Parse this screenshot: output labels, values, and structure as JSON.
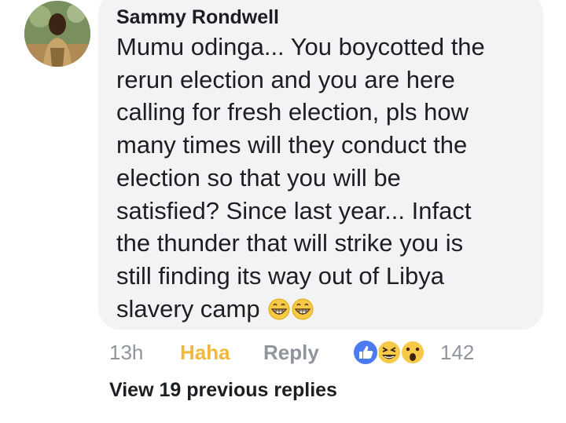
{
  "comment": {
    "author": "Sammy Rondwell",
    "text_lines": [
      "Mumu odinga... You boycotted the",
      "rerun election and you are here",
      "calling for fresh election, pls how",
      "many times will they conduct the",
      "election so that you will be",
      "satisfied? Since last year... Infact",
      "the thunder that will strike you is",
      "still finding its way out of Libya",
      "slavery camp"
    ],
    "inline_emojis": [
      "grinning-face-icon",
      "grinning-face-icon"
    ]
  },
  "actions": {
    "time": "13h",
    "reaction_label": "Haha",
    "reply_label": "Reply",
    "reaction_icons": [
      "like-icon",
      "laughing-face-icon",
      "surprised-face-icon"
    ],
    "reaction_count": "142"
  },
  "replies": {
    "view_label": "View 19 previous replies"
  },
  "colors": {
    "bubble": "#f2f3f5",
    "text": "#1c1e21",
    "muted": "#90949c",
    "haha": "#f0b93c",
    "like_blue": "#4a7bf0"
  }
}
